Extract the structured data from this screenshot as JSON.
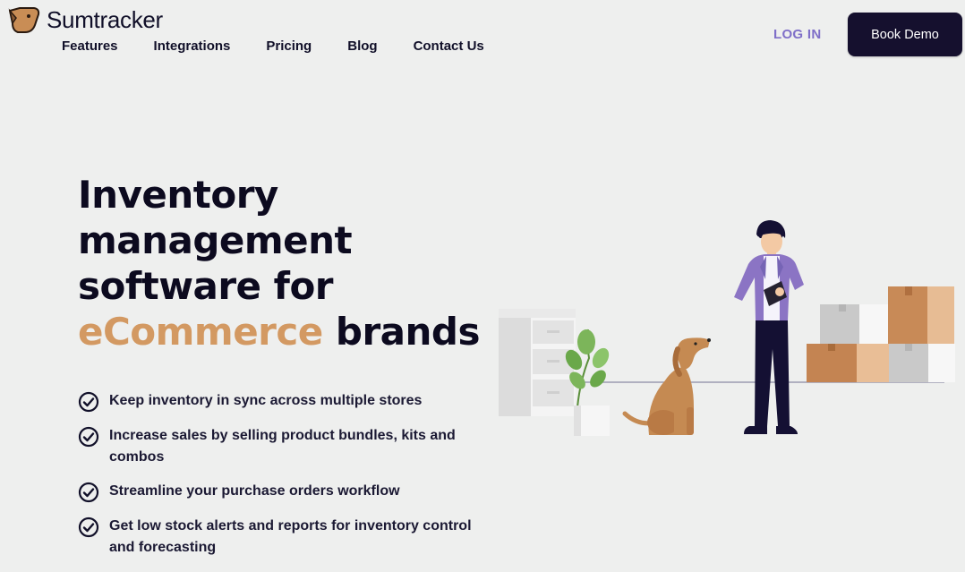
{
  "brand": {
    "name": "Sumtracker",
    "logo_icon": "dog-head-icon",
    "accent_color": "#d39962"
  },
  "nav": {
    "items": [
      {
        "label": "Features"
      },
      {
        "label": "Integrations"
      },
      {
        "label": "Pricing"
      },
      {
        "label": "Blog"
      },
      {
        "label": "Contact Us"
      }
    ],
    "login_label": "LOG IN",
    "demo_label": "Book Demo"
  },
  "hero": {
    "title_lines": [
      "Inventory",
      "management",
      "software for"
    ],
    "title_accent": "eCommerce",
    "title_end": "brands",
    "features": [
      {
        "icon": "check-circle-icon",
        "text": "Keep inventory in sync across multiple stores"
      },
      {
        "icon": "check-circle-icon",
        "text": "Increase sales by selling product bundles, kits and combos"
      },
      {
        "icon": "check-circle-icon",
        "text": "Streamline your purchase orders workflow"
      },
      {
        "icon": "check-circle-icon",
        "text": "Get low stock alerts and reports for inventory control and forecasting"
      }
    ]
  },
  "colors": {
    "background": "#eeefee",
    "dark": "#15102e",
    "login": "#7f6fc8",
    "accent": "#d39962"
  }
}
